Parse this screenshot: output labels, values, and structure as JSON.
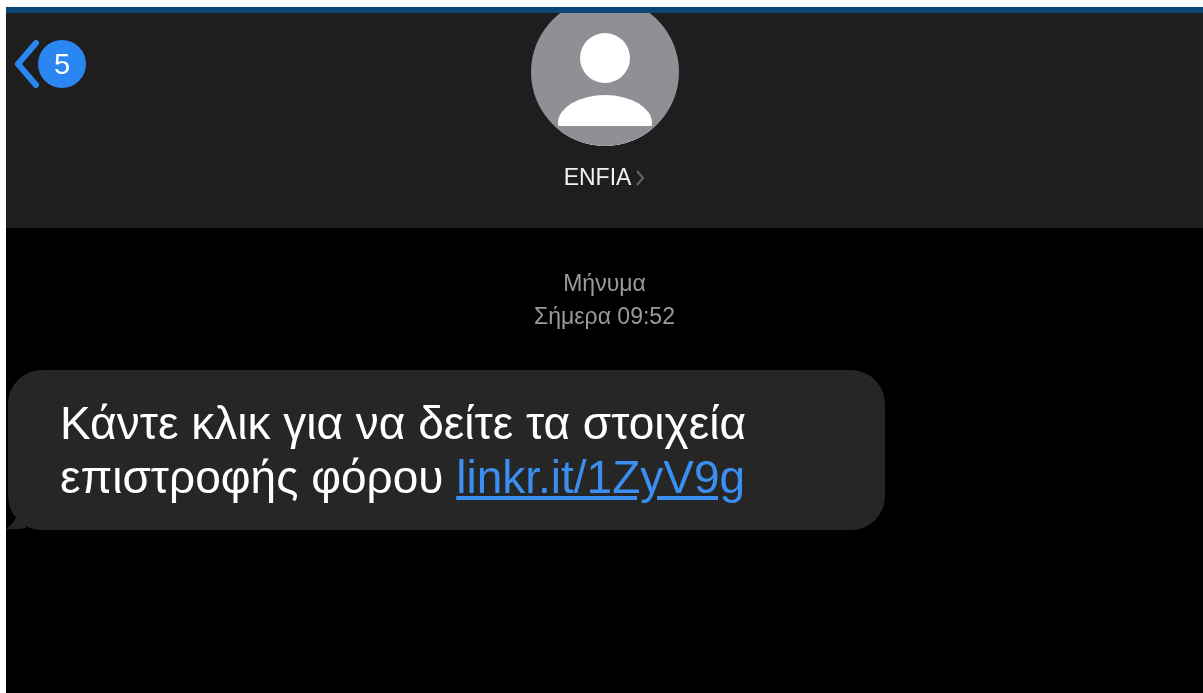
{
  "header": {
    "unread_count": "5",
    "contact_name": "ENFIA"
  },
  "conversation": {
    "service_label": "Μήνυμα",
    "timestamp": "Σήμερα 09:52"
  },
  "messages": [
    {
      "text": "Κάντε κλικ για να δείτε τα στοιχεία επιστροφής φόρου",
      "link": "linkr.it/1ZyV9g"
    }
  ]
}
